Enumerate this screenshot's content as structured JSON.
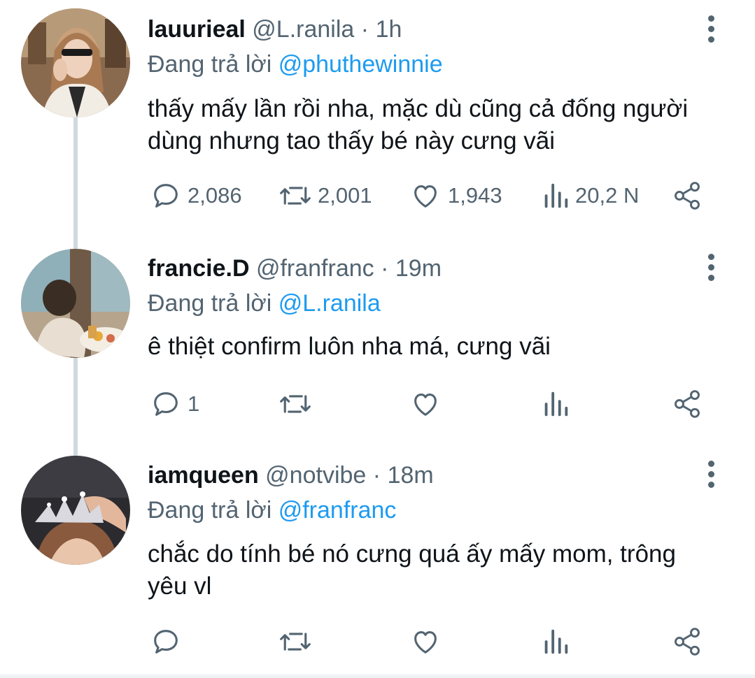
{
  "reply_prefix": "Đang trả lời",
  "separator": "·",
  "tweets": [
    {
      "display_name": "lauurieal",
      "handle": "@L.ranila",
      "time": "1h",
      "reply_to": "@phuthewinnie",
      "text_line1": "thấy mấy lần rồi nha, mặc dù cũng cả đống người",
      "text_line2": "dùng nhưng tao thấy bé này cưng vãi",
      "replies": "2,086",
      "retweets": "2,001",
      "likes": "1,943",
      "views": "20,2 N"
    },
    {
      "display_name": "francie.D",
      "handle": "@franfranc",
      "time": "19m",
      "reply_to": "@L.ranila",
      "text_line1": "ê thiệt confirm luôn nha má, cưng vãi",
      "text_line2": "",
      "replies": "1",
      "retweets": "",
      "likes": "",
      "views": ""
    },
    {
      "display_name": "iamqueen",
      "handle": "@notvibe",
      "time": "18m",
      "reply_to": "@franfranc",
      "text_line1": "chắc do tính bé nó cưng quá ấy mấy mom, trông",
      "text_line2": "yêu vl",
      "replies": "",
      "retweets": "",
      "likes": "",
      "views": ""
    }
  ],
  "colors": {
    "primary_text": "#0f1419",
    "secondary_text": "#536471",
    "mention": "#1d9bf0",
    "thread_line": "#cfd9de"
  },
  "icons": [
    "reply-icon",
    "retweet-icon",
    "like-icon",
    "views-icon",
    "share-icon",
    "more-icon"
  ]
}
